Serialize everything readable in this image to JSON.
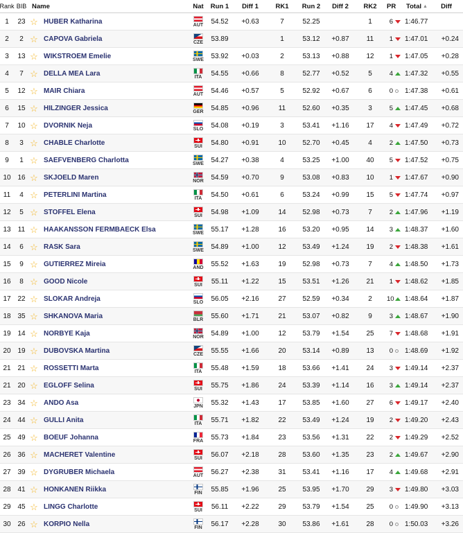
{
  "headers": {
    "rank": "Rank",
    "bib": "BIB",
    "name": "Name",
    "nat": "Nat",
    "run1": "Run 1",
    "diff1": "Diff 1",
    "rk1": "RK1",
    "run2": "Run 2",
    "diff2": "Diff 2",
    "rk2": "RK2",
    "pr": "PR",
    "total": "Total",
    "diff": "Diff"
  },
  "rows": [
    {
      "rank": "1",
      "bib": "23",
      "name": "HUBER Katharina",
      "nat": "AUT",
      "run1": "54.52",
      "diff1": "+0.63",
      "rk1": "7",
      "run2": "52.25",
      "diff2": "",
      "rk2": "1",
      "pr": "6",
      "dir": "down",
      "total": "1:46.77",
      "diff": ""
    },
    {
      "rank": "2",
      "bib": "2",
      "name": "CAPOVA Gabriela",
      "nat": "CZE",
      "run1": "53.89",
      "diff1": "",
      "rk1": "1",
      "run2": "53.12",
      "diff2": "+0.87",
      "rk2": "11",
      "pr": "1",
      "dir": "down",
      "total": "1:47.01",
      "diff": "+0.24"
    },
    {
      "rank": "3",
      "bib": "13",
      "name": "WIKSTROEM Emelie",
      "nat": "SWE",
      "run1": "53.92",
      "diff1": "+0.03",
      "rk1": "2",
      "run2": "53.13",
      "diff2": "+0.88",
      "rk2": "12",
      "pr": "1",
      "dir": "down",
      "total": "1:47.05",
      "diff": "+0.28"
    },
    {
      "rank": "4",
      "bib": "7",
      "name": "DELLA MEA Lara",
      "nat": "ITA",
      "run1": "54.55",
      "diff1": "+0.66",
      "rk1": "8",
      "run2": "52.77",
      "diff2": "+0.52",
      "rk2": "5",
      "pr": "4",
      "dir": "up",
      "total": "1:47.32",
      "diff": "+0.55"
    },
    {
      "rank": "5",
      "bib": "12",
      "name": "MAIR Chiara",
      "nat": "AUT",
      "run1": "54.46",
      "diff1": "+0.57",
      "rk1": "5",
      "run2": "52.92",
      "diff2": "+0.67",
      "rk2": "6",
      "pr": "0",
      "dir": "same",
      "total": "1:47.38",
      "diff": "+0.61"
    },
    {
      "rank": "6",
      "bib": "15",
      "name": "HILZINGER Jessica",
      "nat": "GER",
      "run1": "54.85",
      "diff1": "+0.96",
      "rk1": "11",
      "run2": "52.60",
      "diff2": "+0.35",
      "rk2": "3",
      "pr": "5",
      "dir": "up",
      "total": "1:47.45",
      "diff": "+0.68"
    },
    {
      "rank": "7",
      "bib": "10",
      "name": "DVORNIK Neja",
      "nat": "SLO",
      "run1": "54.08",
      "diff1": "+0.19",
      "rk1": "3",
      "run2": "53.41",
      "diff2": "+1.16",
      "rk2": "17",
      "pr": "4",
      "dir": "down",
      "total": "1:47.49",
      "diff": "+0.72"
    },
    {
      "rank": "8",
      "bib": "3",
      "name": "CHABLE Charlotte",
      "nat": "SUI",
      "run1": "54.80",
      "diff1": "+0.91",
      "rk1": "10",
      "run2": "52.70",
      "diff2": "+0.45",
      "rk2": "4",
      "pr": "2",
      "dir": "up",
      "total": "1:47.50",
      "diff": "+0.73"
    },
    {
      "rank": "9",
      "bib": "1",
      "name": "SAEFVENBERG Charlotta",
      "nat": "SWE",
      "run1": "54.27",
      "diff1": "+0.38",
      "rk1": "4",
      "run2": "53.25",
      "diff2": "+1.00",
      "rk2": "40",
      "pr": "5",
      "dir": "down",
      "total": "1:47.52",
      "diff": "+0.75"
    },
    {
      "rank": "10",
      "bib": "16",
      "name": "SKJOELD Maren",
      "nat": "NOR",
      "run1": "54.59",
      "diff1": "+0.70",
      "rk1": "9",
      "run2": "53.08",
      "diff2": "+0.83",
      "rk2": "10",
      "pr": "1",
      "dir": "down",
      "total": "1:47.67",
      "diff": "+0.90"
    },
    {
      "rank": "11",
      "bib": "4",
      "name": "PETERLINI Martina",
      "nat": "ITA",
      "run1": "54.50",
      "diff1": "+0.61",
      "rk1": "6",
      "run2": "53.24",
      "diff2": "+0.99",
      "rk2": "15",
      "pr": "5",
      "dir": "down",
      "total": "1:47.74",
      "diff": "+0.97"
    },
    {
      "rank": "12",
      "bib": "5",
      "name": "STOFFEL Elena",
      "nat": "SUI",
      "run1": "54.98",
      "diff1": "+1.09",
      "rk1": "14",
      "run2": "52.98",
      "diff2": "+0.73",
      "rk2": "7",
      "pr": "2",
      "dir": "up",
      "total": "1:47.96",
      "diff": "+1.19"
    },
    {
      "rank": "13",
      "bib": "11",
      "name": "HAAKANSSON FERMBAECK Elsa",
      "nat": "SWE",
      "run1": "55.17",
      "diff1": "+1.28",
      "rk1": "16",
      "run2": "53.20",
      "diff2": "+0.95",
      "rk2": "14",
      "pr": "3",
      "dir": "up",
      "total": "1:48.37",
      "diff": "+1.60"
    },
    {
      "rank": "14",
      "bib": "6",
      "name": "RASK Sara",
      "nat": "SWE",
      "run1": "54.89",
      "diff1": "+1.00",
      "rk1": "12",
      "run2": "53.49",
      "diff2": "+1.24",
      "rk2": "19",
      "pr": "2",
      "dir": "down",
      "total": "1:48.38",
      "diff": "+1.61"
    },
    {
      "rank": "15",
      "bib": "9",
      "name": "GUTIERREZ Mireia",
      "nat": "AND",
      "run1": "55.52",
      "diff1": "+1.63",
      "rk1": "19",
      "run2": "52.98",
      "diff2": "+0.73",
      "rk2": "7",
      "pr": "4",
      "dir": "up",
      "total": "1:48.50",
      "diff": "+1.73"
    },
    {
      "rank": "16",
      "bib": "8",
      "name": "GOOD Nicole",
      "nat": "SUI",
      "run1": "55.11",
      "diff1": "+1.22",
      "rk1": "15",
      "run2": "53.51",
      "diff2": "+1.26",
      "rk2": "21",
      "pr": "1",
      "dir": "down",
      "total": "1:48.62",
      "diff": "+1.85"
    },
    {
      "rank": "17",
      "bib": "22",
      "name": "SLOKAR Andreja",
      "nat": "SLO",
      "run1": "56.05",
      "diff1": "+2.16",
      "rk1": "27",
      "run2": "52.59",
      "diff2": "+0.34",
      "rk2": "2",
      "pr": "10",
      "dir": "up",
      "total": "1:48.64",
      "diff": "+1.87"
    },
    {
      "rank": "18",
      "bib": "35",
      "name": "SHKANOVA Maria",
      "nat": "BLR",
      "run1": "55.60",
      "diff1": "+1.71",
      "rk1": "21",
      "run2": "53.07",
      "diff2": "+0.82",
      "rk2": "9",
      "pr": "3",
      "dir": "up",
      "total": "1:48.67",
      "diff": "+1.90"
    },
    {
      "rank": "19",
      "bib": "14",
      "name": "NORBYE Kaja",
      "nat": "NOR",
      "run1": "54.89",
      "diff1": "+1.00",
      "rk1": "12",
      "run2": "53.79",
      "diff2": "+1.54",
      "rk2": "25",
      "pr": "7",
      "dir": "down",
      "total": "1:48.68",
      "diff": "+1.91"
    },
    {
      "rank": "20",
      "bib": "19",
      "name": "DUBOVSKA Martina",
      "nat": "CZE",
      "run1": "55.55",
      "diff1": "+1.66",
      "rk1": "20",
      "run2": "53.14",
      "diff2": "+0.89",
      "rk2": "13",
      "pr": "0",
      "dir": "same",
      "total": "1:48.69",
      "diff": "+1.92"
    },
    {
      "rank": "21",
      "bib": "21",
      "name": "ROSSETTI Marta",
      "nat": "ITA",
      "run1": "55.48",
      "diff1": "+1.59",
      "rk1": "18",
      "run2": "53.66",
      "diff2": "+1.41",
      "rk2": "24",
      "pr": "3",
      "dir": "down",
      "total": "1:49.14",
      "diff": "+2.37"
    },
    {
      "rank": "21",
      "bib": "20",
      "name": "EGLOFF Selina",
      "nat": "SUI",
      "run1": "55.75",
      "diff1": "+1.86",
      "rk1": "24",
      "run2": "53.39",
      "diff2": "+1.14",
      "rk2": "16",
      "pr": "3",
      "dir": "up",
      "total": "1:49.14",
      "diff": "+2.37"
    },
    {
      "rank": "23",
      "bib": "34",
      "name": "ANDO Asa",
      "nat": "JPN",
      "run1": "55.32",
      "diff1": "+1.43",
      "rk1": "17",
      "run2": "53.85",
      "diff2": "+1.60",
      "rk2": "27",
      "pr": "6",
      "dir": "down",
      "total": "1:49.17",
      "diff": "+2.40"
    },
    {
      "rank": "24",
      "bib": "44",
      "name": "GULLI Anita",
      "nat": "ITA",
      "run1": "55.71",
      "diff1": "+1.82",
      "rk1": "22",
      "run2": "53.49",
      "diff2": "+1.24",
      "rk2": "19",
      "pr": "2",
      "dir": "down",
      "total": "1:49.20",
      "diff": "+2.43"
    },
    {
      "rank": "25",
      "bib": "49",
      "name": "BOEUF Johanna",
      "nat": "FRA",
      "run1": "55.73",
      "diff1": "+1.84",
      "rk1": "23",
      "run2": "53.56",
      "diff2": "+1.31",
      "rk2": "22",
      "pr": "2",
      "dir": "down",
      "total": "1:49.29",
      "diff": "+2.52"
    },
    {
      "rank": "26",
      "bib": "36",
      "name": "MACHERET Valentine",
      "nat": "SUI",
      "run1": "56.07",
      "diff1": "+2.18",
      "rk1": "28",
      "run2": "53.60",
      "diff2": "+1.35",
      "rk2": "23",
      "pr": "2",
      "dir": "up",
      "total": "1:49.67",
      "diff": "+2.90"
    },
    {
      "rank": "27",
      "bib": "39",
      "name": "DYGRUBER Michaela",
      "nat": "AUT",
      "run1": "56.27",
      "diff1": "+2.38",
      "rk1": "31",
      "run2": "53.41",
      "diff2": "+1.16",
      "rk2": "17",
      "pr": "4",
      "dir": "up",
      "total": "1:49.68",
      "diff": "+2.91"
    },
    {
      "rank": "28",
      "bib": "41",
      "name": "HONKANEN Riikka",
      "nat": "FIN",
      "run1": "55.85",
      "diff1": "+1.96",
      "rk1": "25",
      "run2": "53.95",
      "diff2": "+1.70",
      "rk2": "29",
      "pr": "3",
      "dir": "down",
      "total": "1:49.80",
      "diff": "+3.03"
    },
    {
      "rank": "29",
      "bib": "45",
      "name": "LINGG Charlotte",
      "nat": "SUI",
      "run1": "56.11",
      "diff1": "+2.22",
      "rk1": "29",
      "run2": "53.79",
      "diff2": "+1.54",
      "rk2": "25",
      "pr": "0",
      "dir": "same",
      "total": "1:49.90",
      "diff": "+3.13"
    },
    {
      "rank": "30",
      "bib": "26",
      "name": "KORPIO Nella",
      "nat": "FIN",
      "run1": "56.17",
      "diff1": "+2.28",
      "rk1": "30",
      "run2": "53.86",
      "diff2": "+1.61",
      "rk2": "28",
      "pr": "0",
      "dir": "same",
      "total": "1:50.03",
      "diff": "+3.26"
    }
  ],
  "flag_icons": {
    "AUT": "austria-flag-icon",
    "CZE": "czech-flag-icon",
    "SWE": "sweden-flag-icon",
    "ITA": "italy-flag-icon",
    "GER": "germany-flag-icon",
    "SLO": "slovenia-flag-icon",
    "SUI": "switzerland-flag-icon",
    "NOR": "norway-flag-icon",
    "AND": "andorra-flag-icon",
    "BLR": "belarus-flag-icon",
    "JPN": "japan-flag-icon",
    "FRA": "france-flag-icon",
    "FIN": "finland-flag-icon"
  },
  "colors": {
    "name_text": "#2a3270",
    "star": "#f2b21b",
    "up_arrow": "#3aa63a",
    "down_arrow": "#d9252a"
  }
}
